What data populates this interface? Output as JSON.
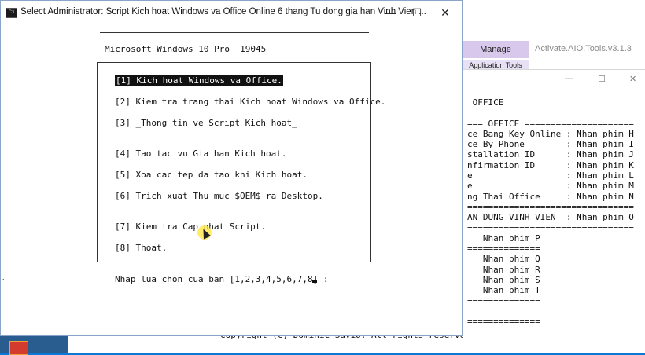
{
  "front_window": {
    "title": "Select Administrator:  Script Kich hoat Windows va Office Online 6 thang Tu dong gia han Vinh Vien ...",
    "icon_label": "C:\\",
    "controls": {
      "minimize": "—",
      "maximize": "☐",
      "close": "✕"
    },
    "os_line": "Microsoft Windows 10 Pro  19045",
    "menu": [
      "[1] Kich hoat Windows va Office.",
      "[2] Kiem tra trang thai Kich hoat Windows va Office.",
      "[3] _Thong tin ve Script Kich hoat_",
      "[4] Tao tac vu Gia han Kich hoat.",
      "[5] Xoa cac tep da tao khi Kich hoat.",
      "[6] Trich xuat Thu muc $OEM$ ra Desktop.",
      "[7] Kiem tra Cap nhat Script.",
      "[8] Thoat."
    ],
    "prompt": "Nhap lua chon cua ban [1,2,3,4,5,6,7,8] :",
    "left_dot": "."
  },
  "back_window": {
    "title": "Activate.AIO.Tools.v3.1.3",
    "ribbon": {
      "manage": "Manage",
      "application_tools": "Application Tools"
    },
    "controls": {
      "minimize": "—",
      "maximize": "☐",
      "close": "✕"
    },
    "lines": [
      " OFFICE",
      "",
      "=== OFFICE =====================",
      "ce Bang Key Online : Nhan phim H",
      "ce By Phone        : Nhan phim I",
      "stallation ID      : Nhan phim J",
      "nfirmation ID      : Nhan phim K",
      "e                  : Nhan phim L",
      "e                  : Nhan phim M",
      "ng Thai Office     : Nhan phim N",
      "================================",
      "AN DUNG VINH VIEN  : Nhan phim O",
      "================================",
      "   Nhan phim P",
      "==============",
      "   Nhan phim Q",
      "   Nhan phim R",
      "   Nhan phim S",
      "   Nhan phim T",
      "==============",
      "",
      "=============="
    ]
  },
  "bottom": {
    "copyright": "Copyright (C) Dominic Savio. All rights reserved."
  }
}
